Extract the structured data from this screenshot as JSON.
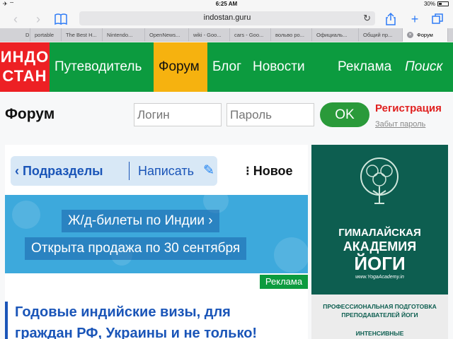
{
  "status": {
    "time": "6:25 AM",
    "battery": "30%",
    "battery_level": 0.3,
    "signal": "✈ ⌔"
  },
  "toolbar": {
    "url": "indostan.guru"
  },
  "tabs": [
    {
      "label": "D"
    },
    {
      "label": "portable"
    },
    {
      "label": "The Best H..."
    },
    {
      "label": "Nintendo..."
    },
    {
      "label": "OpenNews..."
    },
    {
      "label": "wiki - Goo..."
    },
    {
      "label": "cars - Goo..."
    },
    {
      "label": "вольво ро..."
    },
    {
      "label": "Официаль..."
    },
    {
      "label": "Общий пр..."
    },
    {
      "label": "Форум"
    }
  ],
  "site": {
    "logo_line1": "ИНДО",
    "logo_line2": "СТАН",
    "nav": [
      "Путеводитель",
      "Форум",
      "Блог",
      "Новости",
      "Реклама",
      "Поиск"
    ],
    "colors": {
      "nav_bg": "#0c9b3f",
      "logo_bg": "#ed2024",
      "active_bg": "#f6b20f"
    }
  },
  "forum": {
    "title": "Форум",
    "login_placeholder": "Логин",
    "password_placeholder": "Пароль",
    "ok_label": "OK",
    "register": "Регистрация",
    "forgot": "Забыт пароль"
  },
  "main": {
    "sections_label": "‹ Подразделы",
    "write_label": "Написать",
    "new_label": "⁝ Новое",
    "banner_line1": "Ж/д-билеты по Индии  ›",
    "banner_line2": "Открыта продажа по 30 сентября",
    "ad_label": "Реклама",
    "article_title_1": "Годовые индийские визы, для",
    "article_title_2": "граждан РФ, Украины и не только!"
  },
  "side_ad": {
    "line1": "ГИМАЛАЙСКАЯ",
    "line2": "АКАДЕМИЯ",
    "line3": "ЙОГИ",
    "site": "www.YogaAcademy.in",
    "desc1": "ПРОФЕССИОНАЛЬНАЯ ПОДГОТОВКА",
    "desc2": "ПРЕПОДАВАТЕЛЕЙ ЙОГИ",
    "desc3": "ИНТЕНСИВНЫЕ"
  }
}
